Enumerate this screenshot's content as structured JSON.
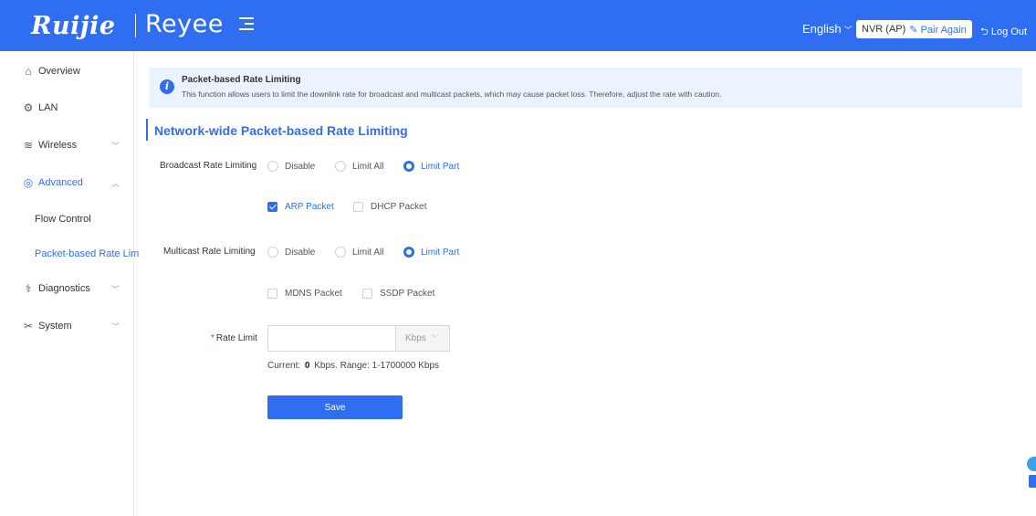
{
  "header": {
    "brand_ruijie": "Ruijie",
    "brand_reyee": "Reyee",
    "language": "English",
    "device_badge": "NVR (AP)",
    "pair_again": "Pair Again",
    "logout": "Log Out"
  },
  "sidebar": {
    "items": [
      {
        "label": "Overview",
        "icon": "home-icon"
      },
      {
        "label": "LAN",
        "icon": "gear-icon"
      },
      {
        "label": "Wireless",
        "icon": "wifi-icon"
      },
      {
        "label": "Advanced",
        "icon": "advanced-icon"
      },
      {
        "label": "Diagnostics",
        "icon": "stethoscope-icon"
      },
      {
        "label": "System",
        "icon": "tools-icon"
      }
    ],
    "subitems": [
      {
        "label": "Flow Control"
      },
      {
        "label": "Packet-based Rate Lim"
      }
    ]
  },
  "info": {
    "title": "Packet-based Rate Limiting",
    "text": "This function allows users to limit the downlink rate for broadcast and multicast packets, which may cause packet loss. Therefore, adjust the rate with caution."
  },
  "section": {
    "title": "Network-wide Packet-based Rate Limiting"
  },
  "broadcast": {
    "label": "Broadcast Rate Limiting",
    "options": [
      "Disable",
      "Limit All",
      "Limit Part"
    ],
    "selected": "Limit Part",
    "packets": [
      {
        "label": "ARP Packet",
        "checked": true
      },
      {
        "label": "DHCP Packet",
        "checked": false
      }
    ]
  },
  "multicast": {
    "label": "Multicast Rate Limiting",
    "options": [
      "Disable",
      "Limit All",
      "Limit Part"
    ],
    "selected": "Limit Part",
    "packets": [
      {
        "label": "MDNS Packet",
        "checked": false
      },
      {
        "label": "SSDP Packet",
        "checked": false
      }
    ]
  },
  "rate": {
    "required_mark": "*",
    "label": "Rate Limit",
    "value": "",
    "unit": "Kbps",
    "hint_prefix": "Current:",
    "current": "0",
    "hint_suffix": "Kbps. Range: 1-1700000 Kbps"
  },
  "save_label": "Save",
  "colors": {
    "accent": "#2f6ef0",
    "banner_bg": "#ebf3ff"
  }
}
